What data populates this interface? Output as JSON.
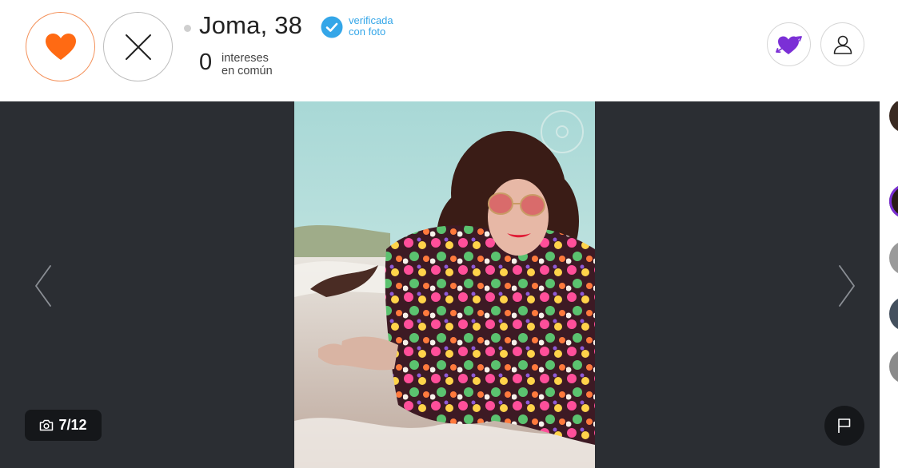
{
  "profile": {
    "name_age": "Joma, 38",
    "verified_label": "verificada\ncon foto",
    "interests_count": "0",
    "interests_label": "intereses\nen común"
  },
  "actions": {
    "like_icon": "heart-icon",
    "pass_icon": "close-icon",
    "crush_icon": "heart-arrow-icon",
    "profile_icon": "user-icon"
  },
  "gallery": {
    "counter": "7/12",
    "counter_icon": "camera-icon",
    "flag_icon": "flag-icon",
    "prev_icon": "chevron-left-icon",
    "next_icon": "chevron-right-icon"
  },
  "colors": {
    "like_accent": "#ff6a13",
    "verified_blue": "#34a6e8",
    "crush_purple": "#7b2fd6",
    "stage_bg": "#2b2e33"
  }
}
